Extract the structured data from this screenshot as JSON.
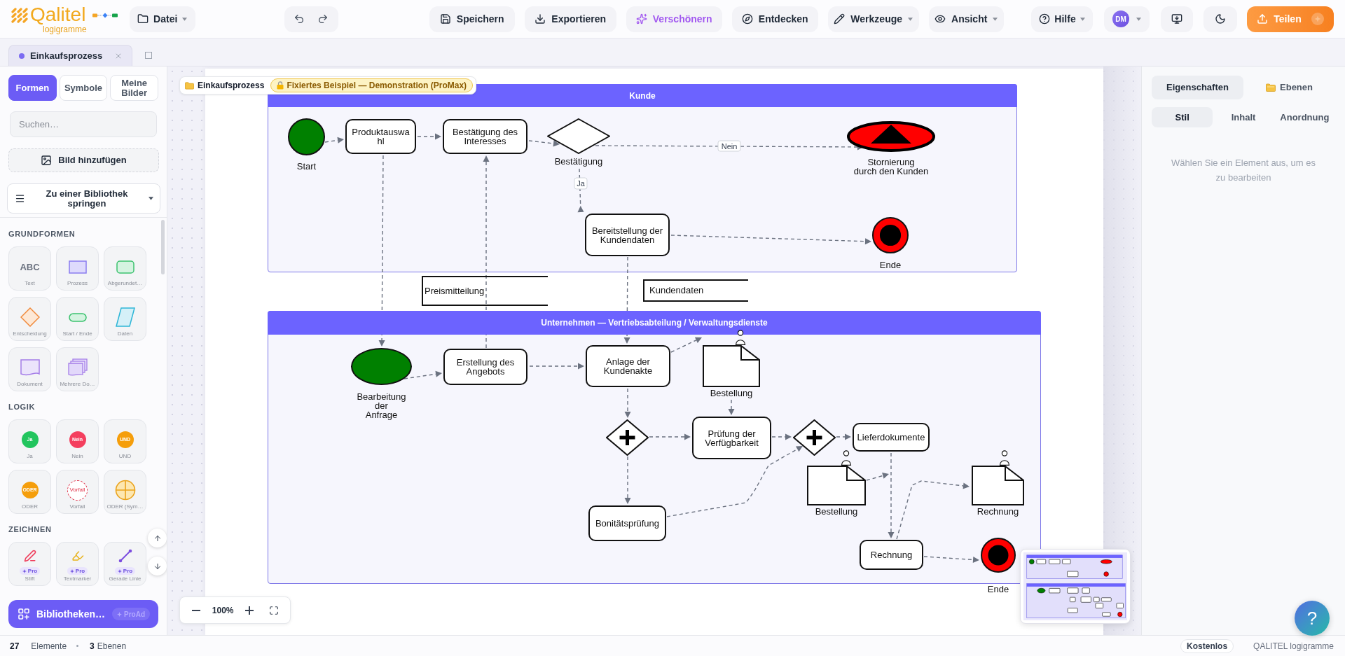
{
  "header": {
    "logo": {
      "name": "Qalitel",
      "tagline": "logigramme"
    },
    "file_menu": {
      "label": "Datei",
      "dropdown": true
    },
    "actions": [
      {
        "kind": "save",
        "label": "Speichern",
        "dropdown": false
      },
      {
        "kind": "export",
        "label": "Exportieren",
        "dropdown": false
      },
      {
        "kind": "beautify",
        "label": "Verschönern",
        "dropdown": false
      },
      {
        "kind": "discover",
        "label": "Entdecken",
        "dropdown": false
      },
      {
        "kind": "tools",
        "label": "Werkzeuge",
        "dropdown": true
      },
      {
        "kind": "view",
        "label": "Ansicht",
        "dropdown": true
      }
    ],
    "help": {
      "label": "Hilfe",
      "dropdown": true
    },
    "user": {
      "initials": "DM",
      "dropdown": true
    },
    "share": {
      "label": "Teilen"
    }
  },
  "document_tabs": [
    {
      "label": "Einkaufsprozess",
      "selected": true
    }
  ],
  "sidebar": {
    "tabs": [
      {
        "label": "Formen",
        "selected": true
      },
      {
        "label": "Symbole",
        "selected": false
      },
      {
        "label": "Meine Bilder",
        "selected": false
      }
    ],
    "search": {
      "placeholder": "Suchen…"
    },
    "add_image": "Bild hinzufügen",
    "library_jump": "Zu einer Bibliothek springen",
    "sections": [
      {
        "title": "GRUNDFORMEN",
        "items": [
          {
            "kind": "text",
            "label": "Text",
            "preview": "ABC"
          },
          {
            "kind": "process",
            "label": "Prozess"
          },
          {
            "kind": "rounded",
            "label": "Abgerundet…"
          },
          {
            "kind": "decision",
            "label": "Entscheidung"
          },
          {
            "kind": "terminator",
            "label": "Start / Ende"
          },
          {
            "kind": "data",
            "label": "Daten"
          },
          {
            "kind": "document",
            "label": "Dokument"
          },
          {
            "kind": "multi_document",
            "label": "Mehrere Do…"
          }
        ]
      },
      {
        "title": "LOGIK",
        "items": [
          {
            "kind": "badge",
            "label": "Ja",
            "preview": "Ja",
            "color": "#22c55e"
          },
          {
            "kind": "badge",
            "label": "Nein",
            "preview": "Nein",
            "color": "#f43f5e"
          },
          {
            "kind": "badge",
            "label": "UND",
            "preview": "UND",
            "color": "#f59e0b"
          },
          {
            "kind": "badge",
            "label": "ODER",
            "preview": "ODER",
            "color": "#f59e0b"
          },
          {
            "kind": "incident",
            "label": "Vorfall",
            "preview": "Vorfall"
          },
          {
            "kind": "or_symbol",
            "label": "ODER (Sym…"
          }
        ]
      },
      {
        "title": "ZEICHNEN",
        "items": [
          {
            "kind": "pen",
            "label": "Stift",
            "badge": "Pro"
          },
          {
            "kind": "highlighter",
            "label": "Textmarker",
            "badge": "Pro"
          },
          {
            "kind": "line",
            "label": "Gerade Linie",
            "badge": "Pro"
          }
        ]
      }
    ],
    "libraries_button": {
      "label": "Bibliotheken…",
      "badge": "ProAd"
    }
  },
  "canvas": {
    "breadcrumb": {
      "title": "Einkaufsprozess",
      "badge": "Fixiertes Beispiel — Demonstration (ProMax)"
    },
    "lanes": [
      {
        "title": "Kunde",
        "nodes": [
          {
            "kind": "start",
            "label": "Start"
          },
          {
            "kind": "task",
            "label": "Produktauswahl"
          },
          {
            "kind": "task",
            "label": "Bestätigung des Interesses"
          },
          {
            "kind": "exclusive_gateway",
            "label": "Bestätigung"
          },
          {
            "kind": "cancel_end",
            "label": "Stornierung\ndurch den Kunden"
          },
          {
            "kind": "task",
            "label": "Bereitstellung der Kundendaten"
          },
          {
            "kind": "end",
            "label": "Ende"
          }
        ]
      },
      {
        "title": "Unternehmen — Vertriebsabteilung / Verwaltungsdienste",
        "nodes": [
          {
            "kind": "start",
            "label": "Bearbeitung\nder\nAnfrage"
          },
          {
            "kind": "task",
            "label": "Erstellung des Angebots"
          },
          {
            "kind": "task",
            "label": "Anlage der Kundenakte"
          },
          {
            "kind": "document",
            "label": "Bestellung"
          },
          {
            "kind": "parallel_gateway"
          },
          {
            "kind": "task",
            "label": "Prüfung der Verfügbarkeit"
          },
          {
            "kind": "parallel_gateway"
          },
          {
            "kind": "task",
            "label": "Lieferdokumente"
          },
          {
            "kind": "document",
            "label": "Bestellung"
          },
          {
            "kind": "document",
            "label": "Rechnung"
          },
          {
            "kind": "task",
            "label": "Bonitätsprüfung"
          },
          {
            "kind": "task",
            "label": "Rechnung"
          },
          {
            "kind": "end",
            "label": "Ende"
          }
        ]
      }
    ],
    "annotations": [
      {
        "label": "Preismitteilung"
      },
      {
        "label": "Kundendaten"
      }
    ],
    "connector_labels": [
      "Nein",
      "Ja"
    ],
    "zoom_level": "100%"
  },
  "properties_panel": {
    "tabs": [
      {
        "kind": "properties",
        "label": "Eigenschaften",
        "selected": true
      },
      {
        "kind": "layers",
        "label": "Ebenen",
        "selected": false
      }
    ],
    "subtabs": [
      {
        "label": "Stil",
        "selected": true
      },
      {
        "label": "Inhalt",
        "selected": false
      },
      {
        "label": "Anordnung",
        "selected": false
      }
    ],
    "empty_message": "Wählen Sie ein Element aus, um es zu bearbeiten"
  },
  "help_button": "?",
  "status_bar": {
    "element_count": "27",
    "element_label": "Elemente",
    "layer_count": "3",
    "layer_label": "Ebenen",
    "plan": "Kostenlos",
    "product": "QALITEL logigramme"
  }
}
